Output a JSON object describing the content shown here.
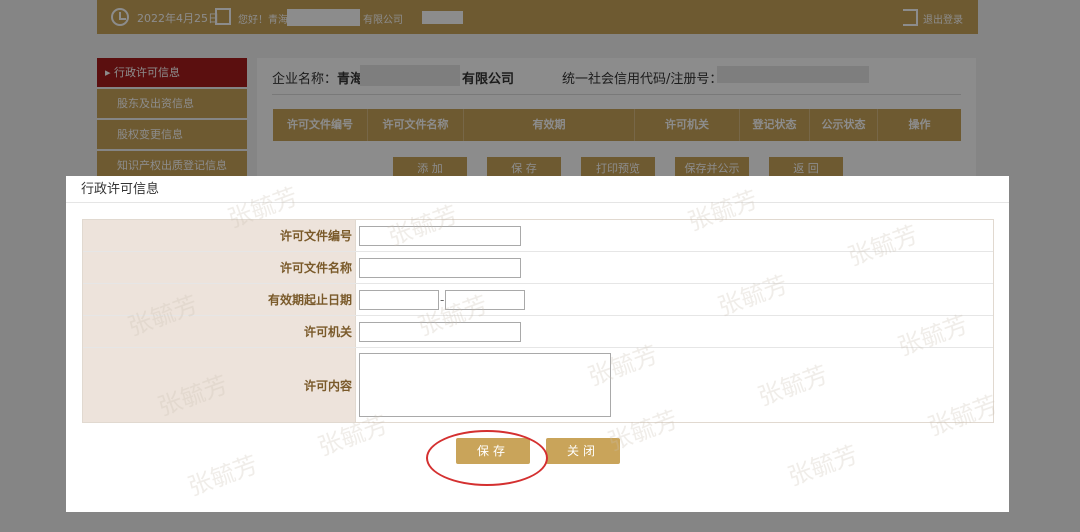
{
  "topbar": {
    "date": "2022年4月25日",
    "greeting": "您好！青海",
    "company_suffix": "有限公司",
    "logout": "退出登录"
  },
  "sidebar": {
    "items": [
      {
        "label": "行政许可信息",
        "active": true
      },
      {
        "label": "股东及出资信息",
        "active": false
      },
      {
        "label": "股权变更信息",
        "active": false
      },
      {
        "label": "知识产权出质登记信息",
        "active": false
      }
    ]
  },
  "content": {
    "company_label": "企业名称：",
    "company_prefix": "青海",
    "company_suffix": "有限公司",
    "credit_label": "统一社会信用代码/注册号：",
    "table_headers": [
      "许可文件编号",
      "许可文件名称",
      "有效期",
      "许可机关",
      "登记状态",
      "公示状态",
      "操作"
    ],
    "buttons": [
      "添 加",
      "保 存",
      "打印预览",
      "保存并公示",
      "返 回"
    ]
  },
  "modal": {
    "title": "行政许可信息",
    "fields": [
      {
        "label": "许可文件编号",
        "value": ""
      },
      {
        "label": "许可文件名称",
        "value": ""
      },
      {
        "label": "有效期起止日期",
        "value_start": "",
        "value_end": ""
      },
      {
        "label": "许可机关",
        "value": ""
      },
      {
        "label": "许可内容",
        "value": ""
      }
    ],
    "date_separator": "-",
    "save_label": "保存",
    "close_label": "关闭"
  },
  "watermark_text": "张毓芳",
  "colors": {
    "accent": "#c9a45a",
    "active_nav": "#a61d1d",
    "label_bg": "#ede3db",
    "highlight": "#d43030"
  }
}
